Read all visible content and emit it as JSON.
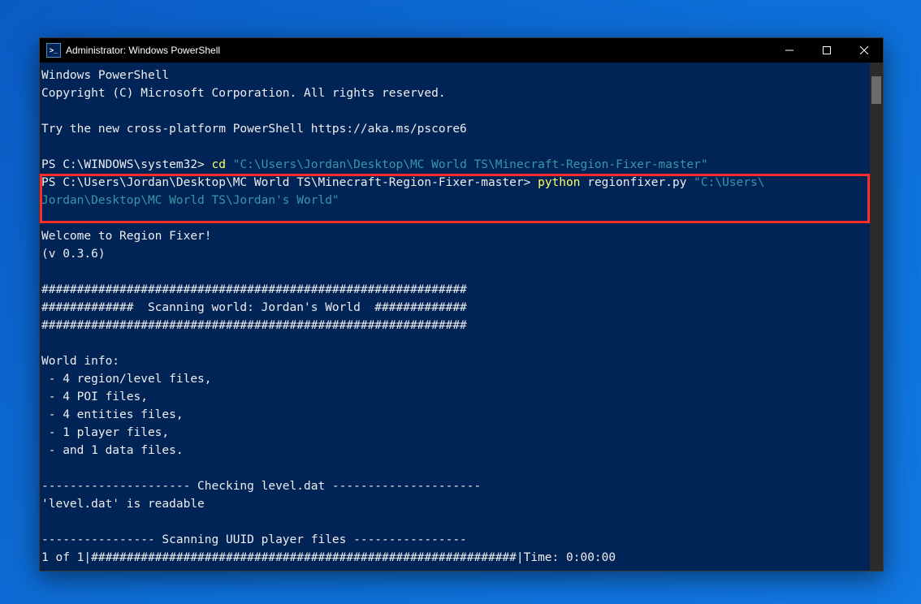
{
  "titlebar": {
    "title": "Administrator: Windows PowerShell"
  },
  "terminal": {
    "banner1": "Windows PowerShell",
    "banner2": "Copyright (C) Microsoft Corporation. All rights reserved.",
    "banner3": "Try the new cross-platform PowerShell https://aka.ms/pscore6",
    "prompt1_prefix": "PS C:\\WINDOWS\\system32> ",
    "prompt1_cmd": "cd",
    "prompt1_arg": " \"C:\\Users\\Jordan\\Desktop\\MC World TS\\Minecraft-Region-Fixer-master\"",
    "prompt2_prefix": "PS C:\\Users\\Jordan\\Desktop\\MC World TS\\Minecraft-Region-Fixer-master> ",
    "prompt2_cmd": "python",
    "prompt2_mid": " regionfixer.py ",
    "prompt2_arg_l1": "\"C:\\Users\\",
    "prompt2_arg_l2": "Jordan\\Desktop\\MC World TS\\Jordan's World\"",
    "welcome": "Welcome to Region Fixer!",
    "version": "(v 0.3.6)",
    "hashline": "############################################################",
    "scanline": "#############  Scanning world: Jordan's World  #############",
    "worldinfo_header": "World info:",
    "wi1": " - 4 region/level files,",
    "wi2": " - 4 POI files,",
    "wi3": " - 4 entities files,",
    "wi4": " - 1 player files,",
    "wi5": " - and 1 data files.",
    "checking": "--------------------- Checking level.dat ---------------------",
    "readable": "'level.dat' is readable",
    "scanning_uuid": "---------------- Scanning UUID player files ----------------",
    "progress": "1 of 1|############################################################|Time: 0:00:00"
  }
}
